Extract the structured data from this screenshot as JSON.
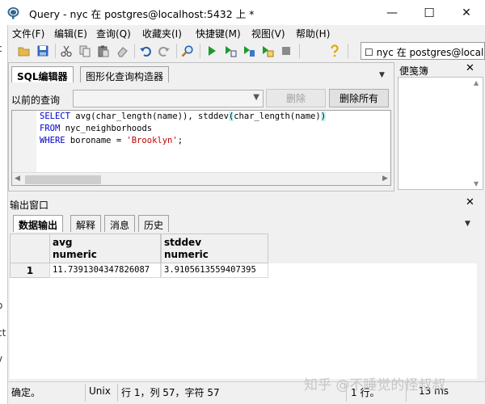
{
  "window": {
    "title": "Query - nyc 在  postgres@localhost:5432 上 *",
    "minimize": "—",
    "maximize": "☐",
    "close": "✕"
  },
  "left_sliver": [
    "c",
    "o",
    "ct",
    "v"
  ],
  "menu": [
    "文件(F)",
    "编辑(E)",
    "查询(Q)",
    "收藏夹(I)",
    "快捷键(M)",
    "视图(V)",
    "帮助(H)"
  ],
  "toolbar": {
    "icons": [
      "folder-open-icon",
      "save-icon",
      "cut-icon",
      "copy-icon",
      "paste-icon",
      "eraser-icon",
      "undo-icon",
      "redo-icon",
      "search-icon",
      "run-icon",
      "run-pgscript-icon",
      "explain-icon",
      "run-to-file-icon",
      "stop-icon",
      "help-icon"
    ],
    "connection": "☐ nyc 在  postgres@localh"
  },
  "editor": {
    "tabs": [
      "SQL编辑器",
      "图形化查询构造器"
    ],
    "history_label": "以前的查询",
    "delete_label": "删除",
    "delete_all_label": "删除所有",
    "sql": {
      "l1_kw": "SELECT",
      "l1_a": " avg(char_length(name)), stddev",
      "l1_paren_open": "(",
      "l1_b": "char_length(name)",
      "l1_paren_close": ")",
      "l2_kw": "FROM",
      "l2_a": " nyc_neighborhoods",
      "l3_kw": "WHERE",
      "l3_a": " boroname = ",
      "l3_str": "'Brooklyn'",
      "l3_end": ";"
    }
  },
  "notes": {
    "title": "便笺簿",
    "close": "✕"
  },
  "output": {
    "title": "输出窗口",
    "close": "✕",
    "tabs": [
      "数据输出",
      "解释",
      "消息",
      "历史"
    ],
    "columns": [
      {
        "name": "avg",
        "type": "numeric"
      },
      {
        "name": "stddev",
        "type": "numeric"
      }
    ],
    "rows": [
      {
        "num": "1",
        "values": [
          "11.7391304347826087",
          "3.9105613559407395"
        ]
      }
    ]
  },
  "status": {
    "ready": "确定。",
    "eol": "Unix",
    "position": "行 1，列 57，字符 57",
    "rows": "1 行。",
    "time": "13 ms"
  },
  "watermark": "知乎 @不睡觉的怪叔叔",
  "colors": {
    "keyword": "#0000cc",
    "string": "#c00000",
    "bracket_highlight": "#c8f5f5"
  }
}
